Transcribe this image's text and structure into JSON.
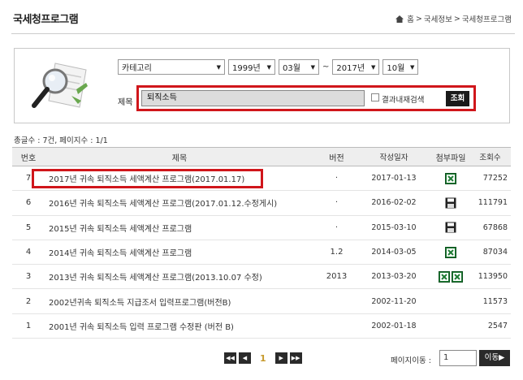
{
  "header": {
    "title": "국세청프로그램",
    "breadcrumb": [
      "홈",
      "국세정보",
      "국세청프로그램"
    ]
  },
  "search": {
    "category": "카테고리",
    "from_year": "1999년",
    "from_month": "03월",
    "tilde": "~",
    "to_year": "2017년",
    "to_month": "10월",
    "title_label": "제목",
    "title_value": "퇴직소득",
    "in_result_label": "결과내재검색",
    "search_button": "조회"
  },
  "summary": "총글수 : 7건, 페이지수 : 1/1",
  "table": {
    "headers": {
      "no": "번호",
      "title": "제목",
      "version": "버전",
      "date": "작성일자",
      "attach": "첨부파일",
      "views": "조회수"
    },
    "rows": [
      {
        "no": "7",
        "title": "2017년 귀속 퇴직소득 세액계산 프로그램(2017.01.17)",
        "version": "·",
        "date": "2017-01-13",
        "attach": [
          "excel"
        ],
        "views": "77252"
      },
      {
        "no": "6",
        "title": "2016년 귀속 퇴직소득 세액계산 프로그램(2017.01.12.수정게시)",
        "version": "·",
        "date": "2016-02-02",
        "attach": [
          "floppy"
        ],
        "views": "111791"
      },
      {
        "no": "5",
        "title": "2015년 귀속 퇴직소득 세액계산 프로그램",
        "version": "·",
        "date": "2015-03-10",
        "attach": [
          "floppy"
        ],
        "views": "67868"
      },
      {
        "no": "4",
        "title": "2014년 귀속 퇴직소득 세액계산 프로그램",
        "version": "1.2",
        "date": "2014-03-05",
        "attach": [
          "excel"
        ],
        "views": "87034"
      },
      {
        "no": "3",
        "title": "2013년 귀속 퇴직소득 세액계산 프로그램(2013.10.07 수정)",
        "version": "2013",
        "date": "2013-03-20",
        "attach": [
          "excel",
          "excel"
        ],
        "views": "113950"
      },
      {
        "no": "2",
        "title": "2002년귀속 퇴직소득 지급조서 입력프로그램(버전B)",
        "version": "",
        "date": "2002-11-20",
        "attach": [],
        "views": "11573"
      },
      {
        "no": "1",
        "title": "2001년 귀속 퇴직소득 입력 프로그램 수정판 (버전 B)",
        "version": "",
        "date": "2002-01-18",
        "attach": [],
        "views": "2547"
      }
    ]
  },
  "pager": {
    "first": "◀◀",
    "prev": "◀",
    "current": "1",
    "next": "▶",
    "last": "▶▶",
    "goto_label": "페이지이동 :",
    "goto_value": "1",
    "goto_button": "이동▶"
  },
  "colors": {
    "highlight": "#d0161b",
    "excel": "#1e7b34",
    "page_current": "#c79a2c"
  }
}
